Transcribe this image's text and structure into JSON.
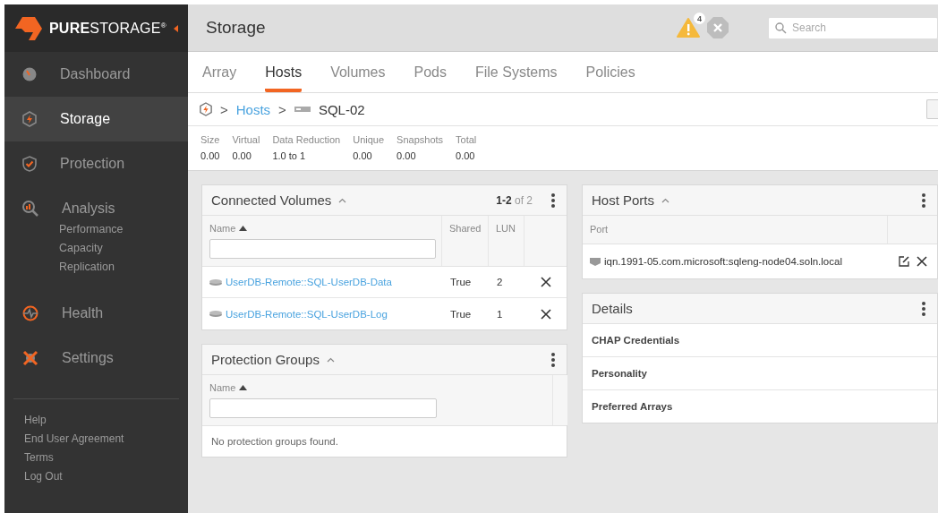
{
  "logo": {
    "text": "**PURE**STORAGE$^{®}$"
  },
  "sidebar": {
    "items": [
      {
        "label": "Dashboard",
        "selected": false
      },
      {
        "label": "Storage",
        "selected": true
      },
      {
        "label": "Protection",
        "selected": false
      },
      {
        "label": "Analysis",
        "selected": false,
        "children": [
          {
            "label": "Performance"
          },
          {
            "label": "Capacity"
          },
          {
            "label": "Replication"
          }
        ]
      },
      {
        "label": "Health",
        "selected": false
      },
      {
        "label": "Settings",
        "selected": false
      }
    ],
    "footer_links": [
      "Help",
      "End User Agreement",
      "Terms",
      "Log Out"
    ]
  },
  "header": {
    "title": "Storage",
    "alert_count": "4",
    "search": {
      "placeholder": "Search"
    }
  },
  "tabs": [
    {
      "label": "Array",
      "selected": false
    },
    {
      "label": "Hosts",
      "selected": true
    },
    {
      "label": "Volumes",
      "selected": false
    },
    {
      "label": "Pods",
      "selected": false
    },
    {
      "label": "File Systems",
      "selected": false
    },
    {
      "label": "Policies",
      "selected": false
    }
  ],
  "breadcrumb": {
    "separator": ">",
    "link": "Hosts",
    "current": "SQL-02"
  },
  "stats": [
    {
      "label": "Size",
      "value": "0.00"
    },
    {
      "label": "Virtual",
      "value": "0.00"
    },
    {
      "label": "Data Reduction",
      "value": "1.0 to 1"
    },
    {
      "label": "Unique",
      "value": "0.00"
    },
    {
      "label": "Snapshots",
      "value": "0.00"
    },
    {
      "label": "Total",
      "value": "0.00"
    }
  ],
  "connected_volumes": {
    "title": "Connected Volumes",
    "count": "**1-2** of 2",
    "columns": [
      "Name",
      "Shared",
      "LUN"
    ],
    "rows": [
      {
        "name": "UserDB-Remote::SQL-UserDB-Data",
        "shared": "True",
        "lun": "2"
      },
      {
        "name": "UserDB-Remote::SQL-UserDB-Log",
        "shared": "True",
        "lun": "1"
      }
    ]
  },
  "protection_groups": {
    "title": "Protection Groups",
    "columns": [
      "Name"
    ],
    "empty": "No protection groups found."
  },
  "host_ports": {
    "title": "Host Ports",
    "columns": [
      "Port"
    ],
    "rows": [
      {
        "port": "iqn.1991-05.com.microsoft:sqleng-node04.soln.local"
      }
    ]
  },
  "details": {
    "title": "Details",
    "rows": [
      "CHAP Credentials",
      "Personality",
      "Preferred Arrays"
    ]
  }
}
